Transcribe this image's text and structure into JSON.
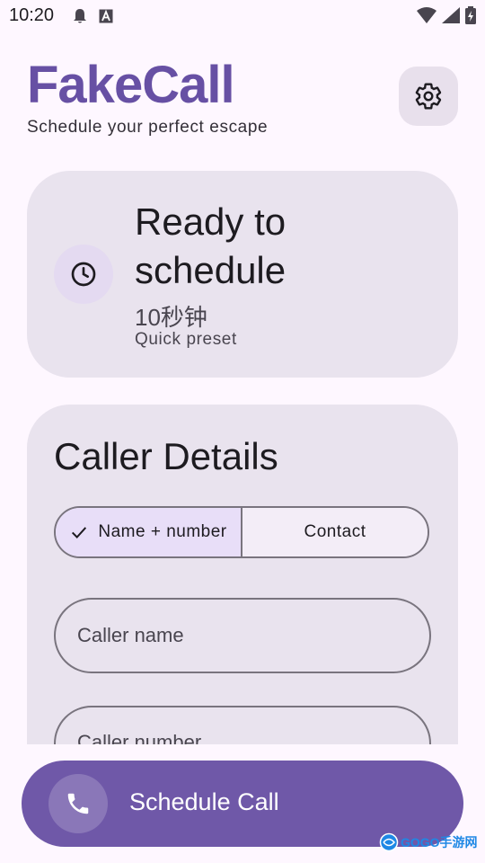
{
  "status_bar": {
    "time": "10:20",
    "left_icons": [
      "notification-bell-icon",
      "text-a-icon"
    ],
    "right_icons": [
      "wifi-icon",
      "signal-icon",
      "battery-icon"
    ]
  },
  "header": {
    "title": "FakeCall",
    "subtitle": "Schedule your perfect escape",
    "settings_icon": "gear-icon"
  },
  "status_card": {
    "icon": "clock-icon",
    "headline": "Ready to schedule",
    "duration": "10秒钟",
    "caption": "Quick preset"
  },
  "caller_details": {
    "title": "Caller Details",
    "segments": [
      {
        "label": "Name + number",
        "selected": true
      },
      {
        "label": "Contact",
        "selected": false
      }
    ],
    "name_placeholder": "Caller name",
    "number_placeholder": "Caller number"
  },
  "schedule_button": {
    "icon": "phone-icon",
    "label": "Schedule Call"
  },
  "watermark": {
    "text": "GOGO手游网"
  },
  "colors": {
    "accent": "#6750a4",
    "button": "#6f58a8",
    "card": "#e9e3ee",
    "background": "#fef7ff"
  }
}
